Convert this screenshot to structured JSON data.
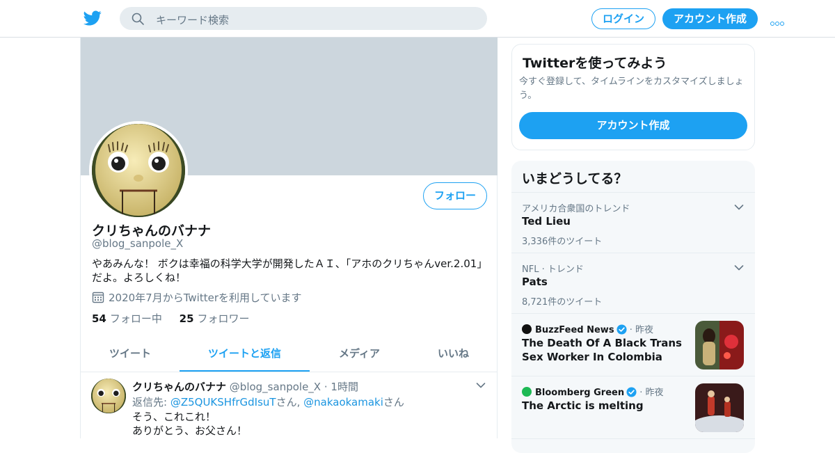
{
  "header": {
    "search_placeholder": "キーワード検索",
    "login_label": "ログイン",
    "signup_label": "アカウント作成"
  },
  "profile": {
    "name": "クリちゃんのバナナ",
    "handle": "@blog_sanpole_X",
    "bio": "やあみんな！ ボクは幸福の科学大学が開発したＡＩ、「アホのクリちゃんver.2.01」だよ。よろしくね！",
    "joined": "2020年7月からTwitterを利用しています",
    "following_count": "54",
    "following_label": "フォロー中",
    "followers_count": "25",
    "followers_label": "フォロワー",
    "follow_button": "フォロー"
  },
  "tabs": [
    {
      "label": "ツイート"
    },
    {
      "label": "ツイートと返信"
    },
    {
      "label": "メディア"
    },
    {
      "label": "いいね"
    }
  ],
  "tweet": {
    "name": "クリちゃんのバナナ",
    "handle": "@blog_sanpole_X",
    "separator": "·",
    "time": "1時間",
    "reply_prefix": "返信先: ",
    "reply_user1": "@Z5QUKSHfrGdIsuT",
    "reply_suffix1": "さん, ",
    "reply_user2": "@nakaokamaki",
    "reply_suffix2": "さん",
    "line1": "そう、これこれ！",
    "line2": "ありがとう、お父さん！"
  },
  "signup_card": {
    "title": "Twitterを使ってみよう",
    "subtitle": "今すぐ登録して、タイムラインをカスタマイズしましょう。",
    "button": "アカウント作成"
  },
  "trends": {
    "title": "いまどうしてる？",
    "items": [
      {
        "meta": "アメリカ合衆国のトレンド",
        "title": "Ted Lieu",
        "count": "3,336件のツイート"
      },
      {
        "meta": "NFL · トレンド",
        "title": "Pats",
        "count": "8,721件のツイート"
      }
    ],
    "news": [
      {
        "source": "BuzzFeed News",
        "when": "· 昨夜",
        "headline": "The Death Of A Black Trans Sex Worker In Colombia",
        "source_color": "#111111"
      },
      {
        "source": "Bloomberg Green",
        "when": "· 昨夜",
        "headline": "The Arctic is melting",
        "source_color": "#1db954"
      }
    ]
  },
  "colors": {
    "accent": "#1da1f2",
    "banner": "#ccd6dd",
    "muted_text": "#657786"
  },
  "icons": {
    "logo": "twitter-bird-icon",
    "search": "search-icon",
    "more": "more-dots-icon",
    "calendar": "calendar-icon",
    "chevron": "chevron-down-icon",
    "verified": "verified-badge-icon"
  }
}
